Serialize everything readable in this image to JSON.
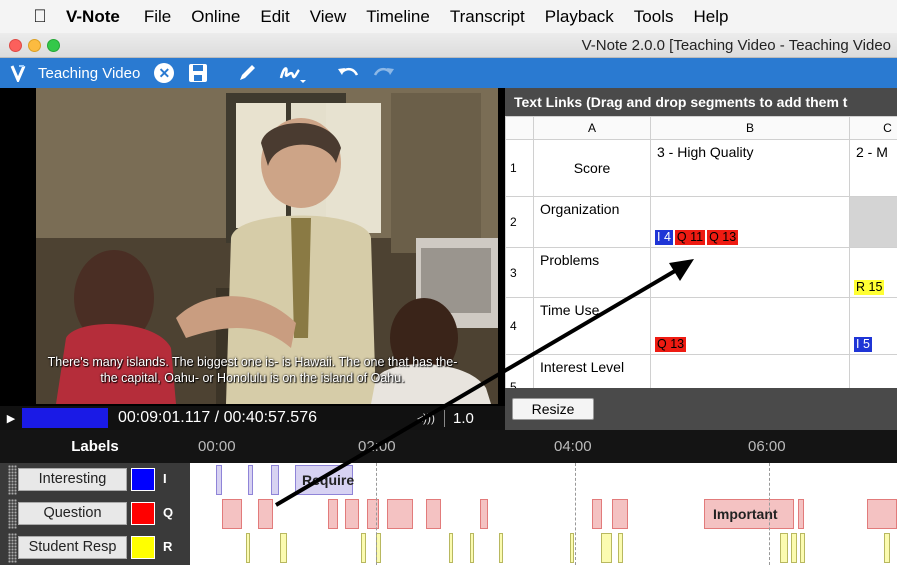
{
  "menubar": {
    "app_name": "V-Note",
    "items": [
      "File",
      "Online",
      "Edit",
      "View",
      "Timeline",
      "Transcript",
      "Playback",
      "Tools",
      "Help"
    ]
  },
  "window": {
    "title": "V-Note 2.0.0 [Teaching Video - Teaching Video"
  },
  "toolbar": {
    "project_name": "Teaching Video"
  },
  "video": {
    "subtitle_line1": "There's many islands. The biggest one is- is Hawaii. The one that has the-",
    "subtitle_line2": "the capital, Oahu- or Honolulu is on the island of Oahu.",
    "timecode": "00:09:01.117 / 00:40:57.576",
    "speed": "1.0",
    "progress_fraction": 0.22
  },
  "text_links": {
    "header": "Text Links (Drag and drop segments to add them t",
    "columns": [
      "A",
      "B",
      "C"
    ],
    "rows": [
      {
        "num": "1",
        "a": "Score",
        "b": "3 - High Quality",
        "c": "2 - M",
        "b_chips": [],
        "c_chips": []
      },
      {
        "num": "2",
        "a": "Organization",
        "b": "",
        "c": "",
        "b_chips": [
          "I 4",
          "Q 11",
          "Q 13"
        ],
        "c_chips": []
      },
      {
        "num": "3",
        "a": "Problems",
        "b": "",
        "c": "",
        "b_chips": [],
        "c_chips": [
          "R 15"
        ]
      },
      {
        "num": "4",
        "a": "Time Use",
        "b": "",
        "c": "",
        "b_chips": [
          "Q 13"
        ],
        "c_chips": [
          "I 5"
        ]
      },
      {
        "num": "5",
        "a": "Interest Level",
        "b": "",
        "c": "",
        "b_chips": [],
        "c_chips": []
      }
    ],
    "resize_label": "Resize"
  },
  "timeline": {
    "labels_header": "Labels",
    "ticks": [
      "00:00",
      "02:00",
      "04:00",
      "06:00"
    ],
    "rows": [
      {
        "name": "Interesting",
        "key": "I",
        "color": "#0000ff"
      },
      {
        "name": "Question",
        "key": "Q",
        "color": "#ff0000"
      },
      {
        "name": "Student Resp",
        "key": "R",
        "color": "#ffff00"
      }
    ],
    "segment_text": {
      "require": "Require",
      "important": "Important"
    }
  },
  "colors": {
    "toolbar": "#2a7ad1",
    "interesting": "#1f35d6",
    "question": "#ee1b12",
    "student": "#ffff33"
  }
}
